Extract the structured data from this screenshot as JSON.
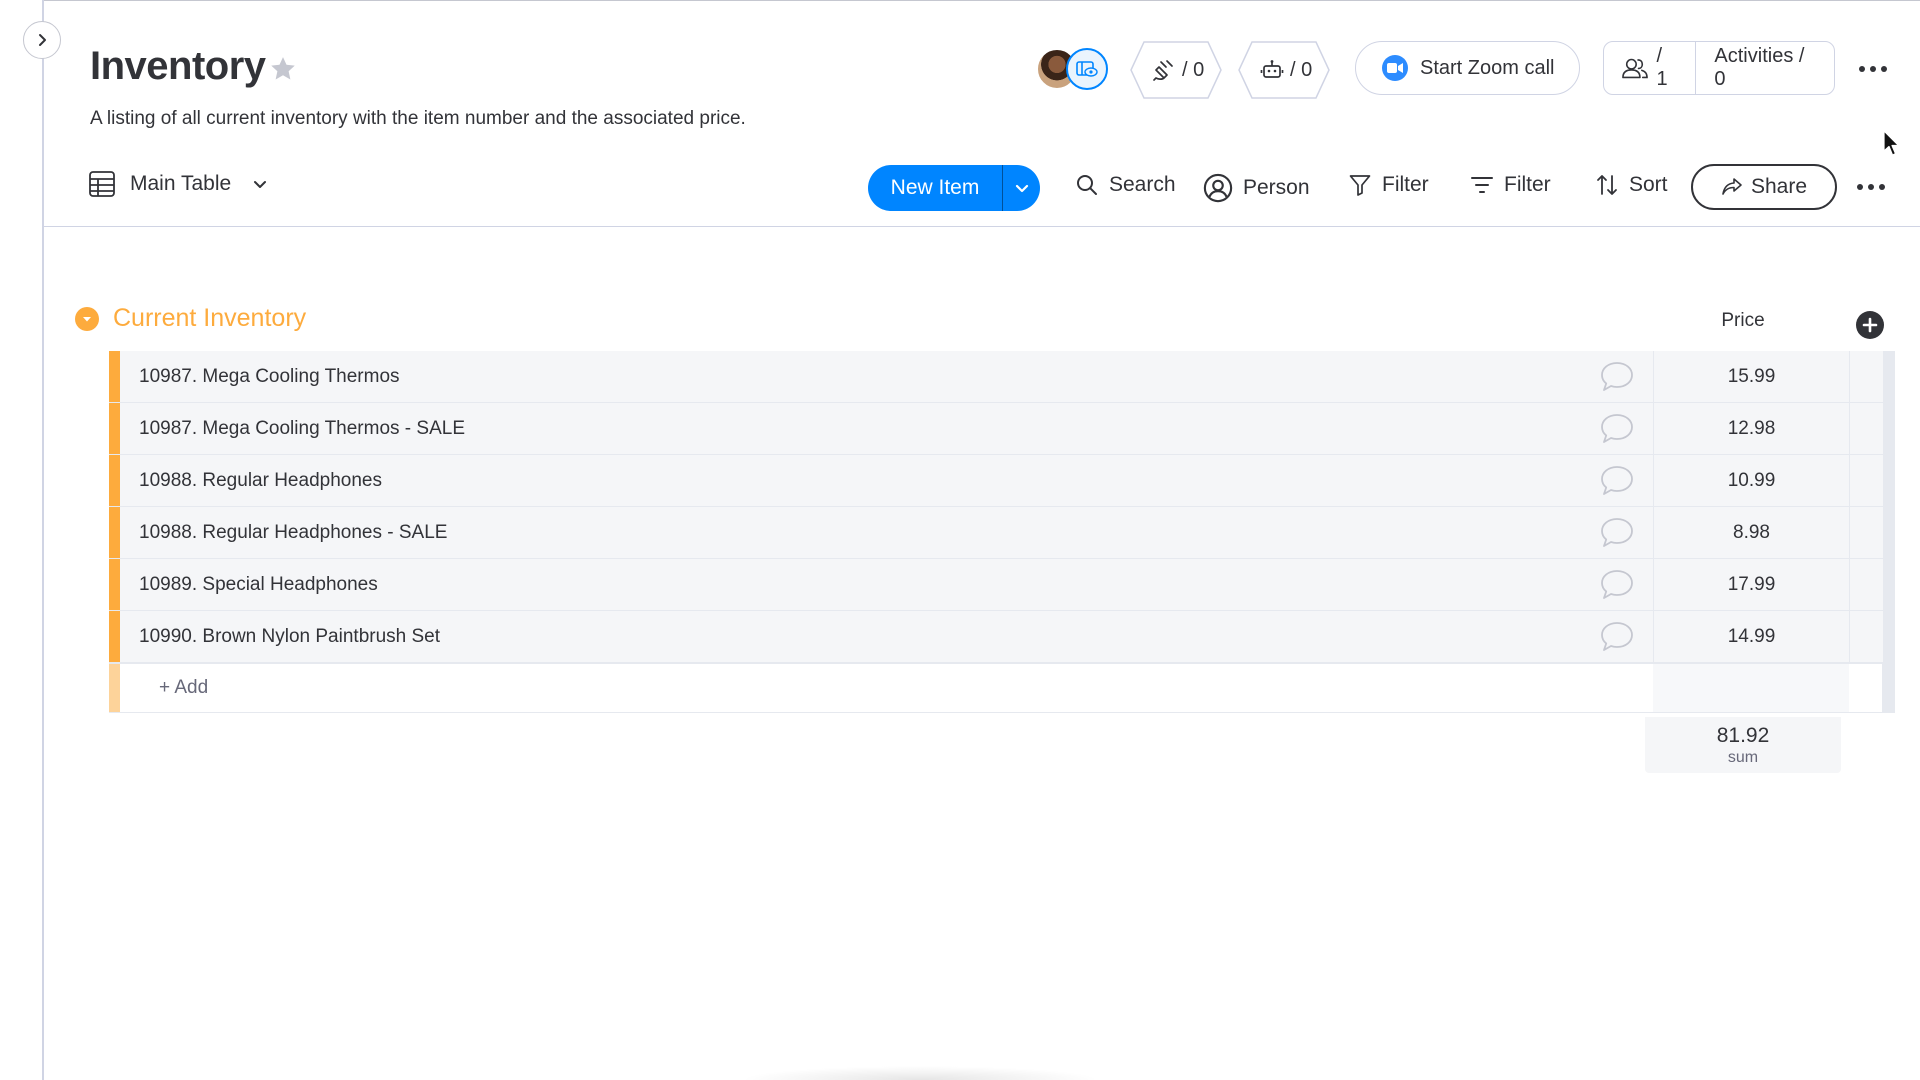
{
  "board": {
    "title": "Inventory",
    "description": "A listing of all current inventory with the item number and the associated price."
  },
  "header": {
    "integrations_count": "/ 0",
    "automations_count": "/ 0",
    "zoom_label": "Start Zoom call",
    "members_count": "/ 1",
    "activities_label": "Activities / 0"
  },
  "toolbar": {
    "view_label": "Main Table",
    "new_item_label": "New Item",
    "search_label": "Search",
    "person_label": "Person",
    "filter_label": "Filter",
    "filter2_label": "Filter",
    "sort_label": "Sort",
    "share_label": "Share"
  },
  "group": {
    "title": "Current Inventory",
    "color": "#fdab3d",
    "price_header": "Price",
    "add_label": "+ Add",
    "sum_value": "81.92",
    "sum_label": "sum"
  },
  "items": [
    {
      "name": "10987. Mega Cooling Thermos",
      "price": "15.99"
    },
    {
      "name": "10987. Mega Cooling Thermos - SALE",
      "price": "12.98"
    },
    {
      "name": "10988. Regular Headphones",
      "price": "10.99"
    },
    {
      "name": "10988. Regular Headphones - SALE",
      "price": "8.98"
    },
    {
      "name": "10989. Special Headphones",
      "price": "17.99"
    },
    {
      "name": "10990. Brown Nylon Paintbrush Set",
      "price": "14.99"
    }
  ],
  "colors": {
    "primary": "#0085ff",
    "group_orange": "#fdab3d",
    "text": "#323338",
    "zoom_blue": "#2d8cff"
  }
}
